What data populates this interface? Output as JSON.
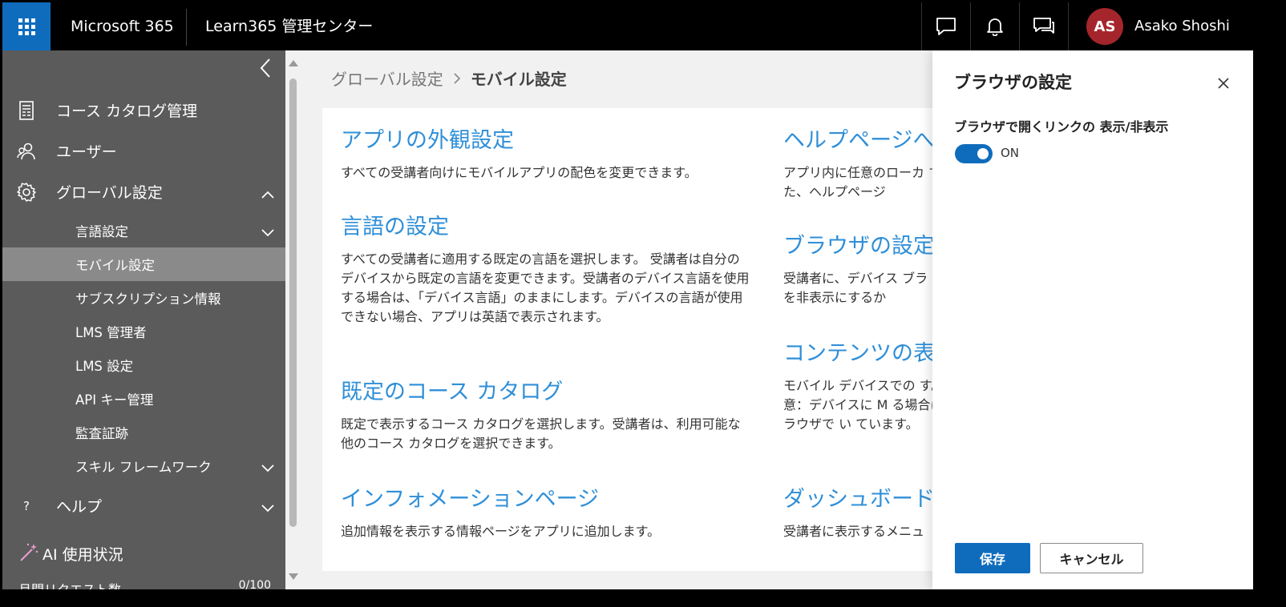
{
  "topbar": {
    "brand": "Microsoft 365",
    "app_title": "Learn365 管理センター",
    "user": {
      "initials": "AS",
      "name": "Asako Shoshi",
      "avatar_color": "#a4262c"
    },
    "icons": [
      "feedback-icon",
      "notification-bell-icon",
      "chat-icon"
    ]
  },
  "sidebar": {
    "items": [
      {
        "label": "コース カタログ管理",
        "icon": "catalog-icon"
      },
      {
        "label": "ユーザー",
        "icon": "users-icon"
      },
      {
        "label": "グローバル設定",
        "icon": "gear-icon",
        "expanded": true
      }
    ],
    "subitems": [
      {
        "label": "言語設定",
        "has_chevron": true
      },
      {
        "label": "モバイル設定",
        "active": true
      },
      {
        "label": "サブスクリプション情報"
      },
      {
        "label": "LMS 管理者"
      },
      {
        "label": "LMS 設定"
      },
      {
        "label": "API キー管理"
      },
      {
        "label": "監査証跡"
      },
      {
        "label": "スキル フレームワーク",
        "has_chevron": true
      }
    ],
    "help": {
      "label": "ヘルプ",
      "icon": "?"
    },
    "ai": {
      "label": "AI 使用状況",
      "icon": "magic-wand-icon"
    },
    "usage": {
      "label": "月間リクエスト数",
      "value": "0/100"
    }
  },
  "breadcrumb": {
    "parent": "グローバル設定",
    "current": "モバイル設定"
  },
  "sections_left": [
    {
      "title": "アプリの外観設定",
      "desc": "すべての受講者向けにモバイルアプリの配色を変更できます。"
    },
    {
      "title": "言語の設定",
      "desc": "すべての受講者に適用する既定の言語を選択します。 受講者は自分のデバイスから既定の言語を変更できます。受講者のデバイス言語を使用する場合は、「デバイス言語」のままにします。デバイスの言語が使用できない場合、アプリは英語で表示されます。"
    },
    {
      "title": "既定のコース カタログ",
      "desc": "既定で表示するコース カタログを選択します。受講者は、利用可能な他のコース カタログを選択できます。"
    },
    {
      "title": "インフォメーションページ",
      "desc": "追加情報を表示する情報ページをアプリに追加します。"
    }
  ],
  "sections_right": [
    {
      "title": "ヘルプページへ",
      "desc": "アプリ内に任意のローカ す。また、ヘルプページ"
    },
    {
      "title": "ブラウザの設定",
      "desc": "受講者に、デバイス ブラ リンクを非表示にするか"
    },
    {
      "title": "コンテンツの表",
      "desc": "モバイル デバイスでの す。注意：デバイスに M る場合は、ブラウザで い ています。"
    },
    {
      "title": "ダッシュボード",
      "desc": "受講者に表示するメニュ"
    }
  ],
  "panel": {
    "title": "ブラウザの設定",
    "field_label": "ブラウザで開くリンクの 表示/非表示",
    "toggle_on": true,
    "toggle_state": "ON",
    "save_label": "保存",
    "cancel_label": "キャンセル"
  },
  "colors": {
    "accent": "#0f6cbd",
    "link": "#2f8fd8",
    "sidebar": "#5b5b5b",
    "sidebar_active": "#8a8a8a"
  }
}
